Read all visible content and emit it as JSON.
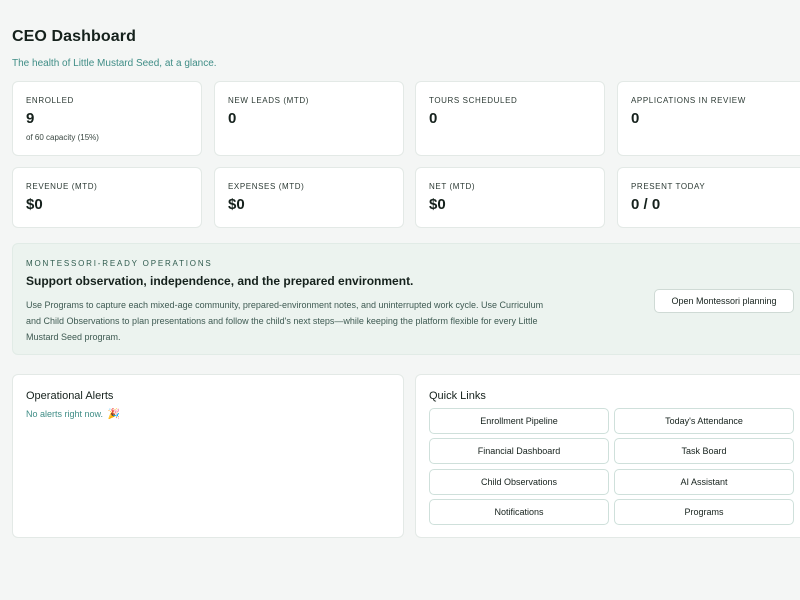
{
  "header": {
    "title": "CEO Dashboard",
    "subtitle": "The health of Little Mustard Seed, at a glance."
  },
  "stats": [
    {
      "label": "ENROLLED",
      "value": "9",
      "sub": "of 60 capacity (15%)"
    },
    {
      "label": "NEW LEADS (MTD)",
      "value": "0"
    },
    {
      "label": "TOURS SCHEDULED",
      "value": "0"
    },
    {
      "label": "APPLICATIONS IN REVIEW",
      "value": "0"
    },
    {
      "label": "REVENUE (MTD)",
      "value": "$0"
    },
    {
      "label": "EXPENSES (MTD)",
      "value": "$0"
    },
    {
      "label": "NET (MTD)",
      "value": "$0"
    },
    {
      "label": "PRESENT TODAY",
      "value": "0 / 0"
    }
  ],
  "montessori": {
    "kicker": "MONTESSORI-READY OPERATIONS",
    "title": "Support observation, independence, and the prepared environment.",
    "body": "Use Programs to capture each mixed-age community, prepared-environment notes, and uninterrupted work cycle. Use Curriculum and Child Observations to plan presentations and follow the child's next steps—while keeping the platform flexible for every Little Mustard Seed program.",
    "button": "Open Montessori planning"
  },
  "alerts": {
    "title": "Operational Alerts",
    "empty": "No alerts right now.",
    "empty_icon": "🎉"
  },
  "quick_links": {
    "title": "Quick Links",
    "items": [
      "Enrollment Pipeline",
      "Today's Attendance",
      "Financial Dashboard",
      "Task Board",
      "Child Observations",
      "AI Assistant",
      "Notifications",
      "Programs"
    ]
  },
  "colors": {
    "accent_teal": "#3f8d86",
    "montessori_bg": "#ecf3ef",
    "page_bg": "#f4f6f5"
  }
}
